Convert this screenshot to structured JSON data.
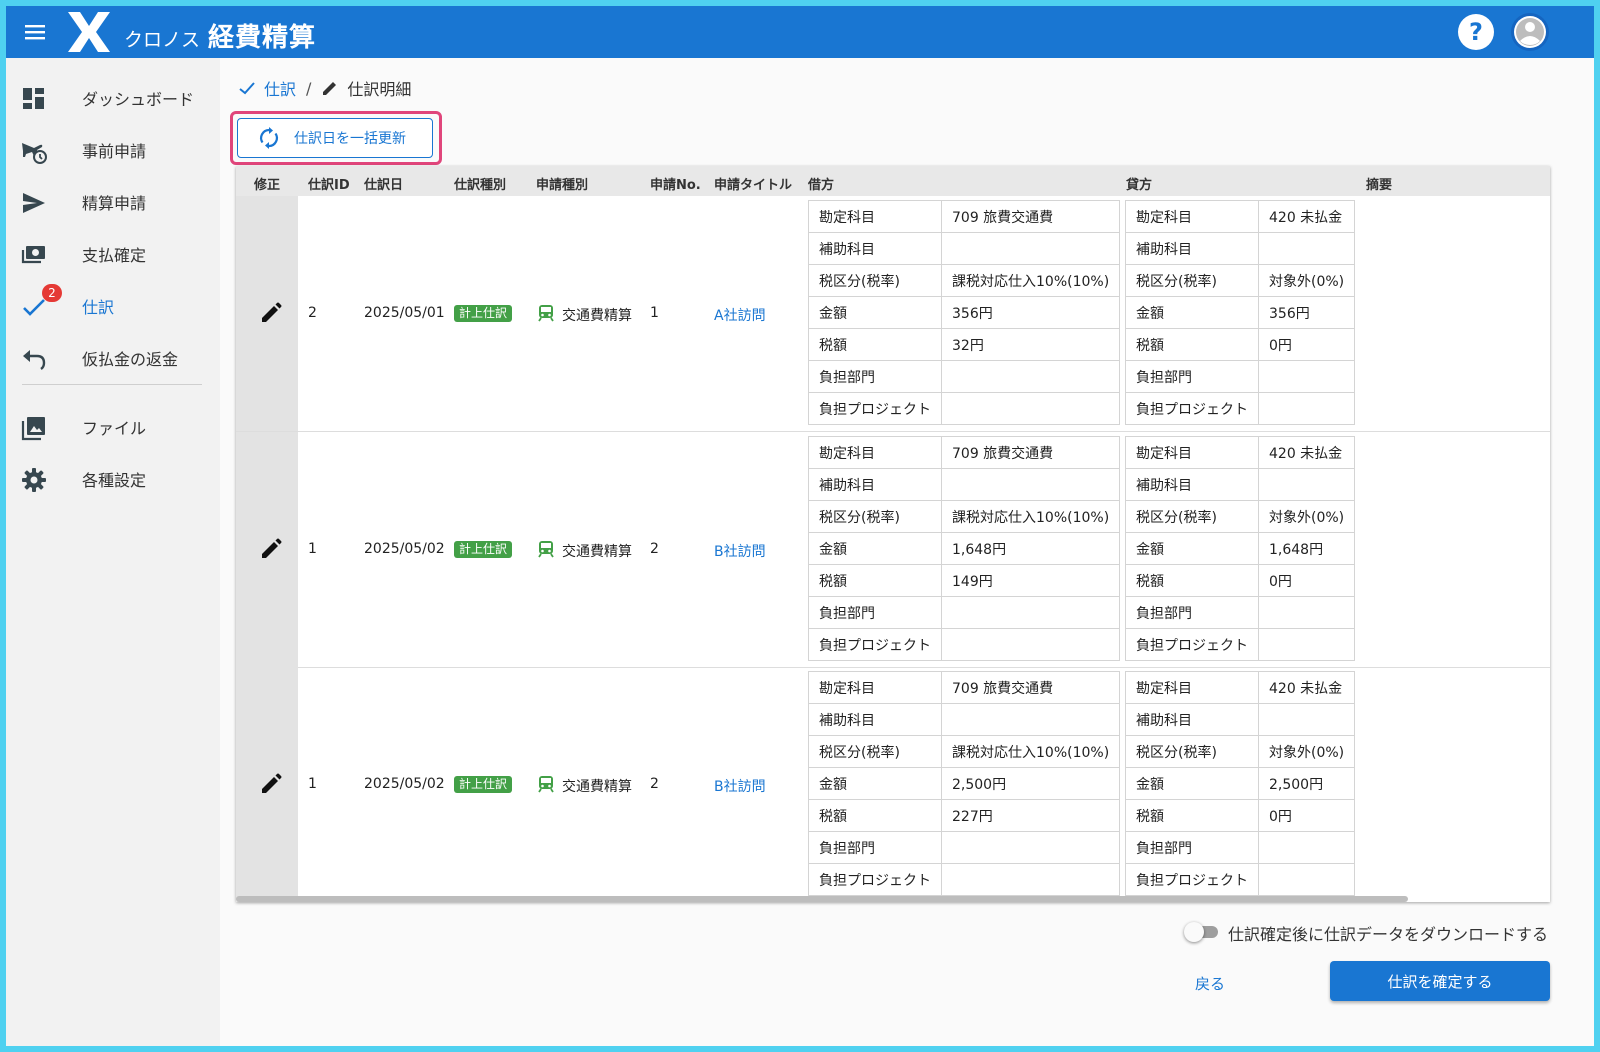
{
  "app": {
    "brand": "クロノス",
    "name": "経費精算"
  },
  "header": {
    "menu_icon": "hamburger-menu-icon",
    "help_icon": "help-circle-icon",
    "avatar_icon": "account-circle-icon"
  },
  "sidebar": {
    "items": [
      {
        "label": "ダッシュボード",
        "icon": "dashboard-icon"
      },
      {
        "label": "事前申請",
        "icon": "airplane-clock-icon"
      },
      {
        "label": "精算申請",
        "icon": "send-icon"
      },
      {
        "label": "支払確定",
        "icon": "cash-icon"
      },
      {
        "label": "仕訳",
        "icon": "check-icon",
        "badge": "2",
        "active": true
      },
      {
        "label": "仮払金の返金",
        "icon": "undo-icon"
      },
      {
        "label": "ファイル",
        "icon": "image-multiple-icon"
      },
      {
        "label": "各種設定",
        "icon": "gear-icon"
      }
    ]
  },
  "breadcrumb": {
    "parent": "仕訳",
    "current": "仕訳明細"
  },
  "bulk_update_button": "仕訳日を一括更新",
  "table": {
    "headers": [
      "修正",
      "仕訳ID",
      "仕訳日",
      "仕訳種別",
      "申請種別",
      "申請No.",
      "申請タイトル",
      "借方",
      "貸方",
      "摘要"
    ],
    "rows": [
      {
        "id": "2",
        "date": "2025/05/01",
        "type": "計上仕訳",
        "app_type": "交通費精算",
        "app_no": "1",
        "title": "A社訪問",
        "debit": [
          {
            "k": "勘定科目",
            "v": "709 旅費交通費"
          },
          {
            "k": "補助科目",
            "v": ""
          },
          {
            "k": "税区分(税率)",
            "v": "課税対応仕入10%(10%)"
          },
          {
            "k": "金額",
            "v": "356円"
          },
          {
            "k": "税額",
            "v": "32円"
          },
          {
            "k": "負担部門",
            "v": ""
          },
          {
            "k": "負担プロジェクト",
            "v": ""
          }
        ],
        "credit": [
          {
            "k": "勘定科目",
            "v": "420 未払金"
          },
          {
            "k": "補助科目",
            "v": ""
          },
          {
            "k": "税区分(税率)",
            "v": "対象外(0%)"
          },
          {
            "k": "金額",
            "v": "356円"
          },
          {
            "k": "税額",
            "v": "0円"
          },
          {
            "k": "負担部門",
            "v": ""
          },
          {
            "k": "負担プロジェクト",
            "v": ""
          }
        ]
      },
      {
        "id": "1",
        "date": "2025/05/02",
        "type": "計上仕訳",
        "app_type": "交通費精算",
        "app_no": "2",
        "title": "B社訪問",
        "debit": [
          {
            "k": "勘定科目",
            "v": "709 旅費交通費"
          },
          {
            "k": "補助科目",
            "v": ""
          },
          {
            "k": "税区分(税率)",
            "v": "課税対応仕入10%(10%)"
          },
          {
            "k": "金額",
            "v": "1,648円"
          },
          {
            "k": "税額",
            "v": "149円"
          },
          {
            "k": "負担部門",
            "v": ""
          },
          {
            "k": "負担プロジェクト",
            "v": ""
          }
        ],
        "credit": [
          {
            "k": "勘定科目",
            "v": "420 未払金"
          },
          {
            "k": "補助科目",
            "v": ""
          },
          {
            "k": "税区分(税率)",
            "v": "対象外(0%)"
          },
          {
            "k": "金額",
            "v": "1,648円"
          },
          {
            "k": "税額",
            "v": "0円"
          },
          {
            "k": "負担部門",
            "v": ""
          },
          {
            "k": "負担プロジェクト",
            "v": ""
          }
        ]
      },
      {
        "id": "1",
        "date": "2025/05/02",
        "type": "計上仕訳",
        "app_type": "交通費精算",
        "app_no": "2",
        "title": "B社訪問",
        "debit": [
          {
            "k": "勘定科目",
            "v": "709 旅費交通費"
          },
          {
            "k": "補助科目",
            "v": ""
          },
          {
            "k": "税区分(税率)",
            "v": "課税対応仕入10%(10%)"
          },
          {
            "k": "金額",
            "v": "2,500円"
          },
          {
            "k": "税額",
            "v": "227円"
          },
          {
            "k": "負担部門",
            "v": ""
          },
          {
            "k": "負担プロジェクト",
            "v": ""
          }
        ],
        "credit": [
          {
            "k": "勘定科目",
            "v": "420 未払金"
          },
          {
            "k": "補助科目",
            "v": ""
          },
          {
            "k": "税区分(税率)",
            "v": "対象外(0%)"
          },
          {
            "k": "金額",
            "v": "2,500円"
          },
          {
            "k": "税額",
            "v": "0円"
          },
          {
            "k": "負担部門",
            "v": ""
          },
          {
            "k": "負担プロジェクト",
            "v": ""
          }
        ]
      }
    ]
  },
  "footer": {
    "download_toggle_label": "仕訳確定後に仕訳データをダウンロードする",
    "download_toggle_on": false,
    "back_label": "戻る",
    "confirm_label": "仕訳を確定する"
  },
  "colors": {
    "primary": "#1976d2",
    "chip": "#43a047",
    "badge": "#e53935",
    "highlight": "#e0457b"
  }
}
